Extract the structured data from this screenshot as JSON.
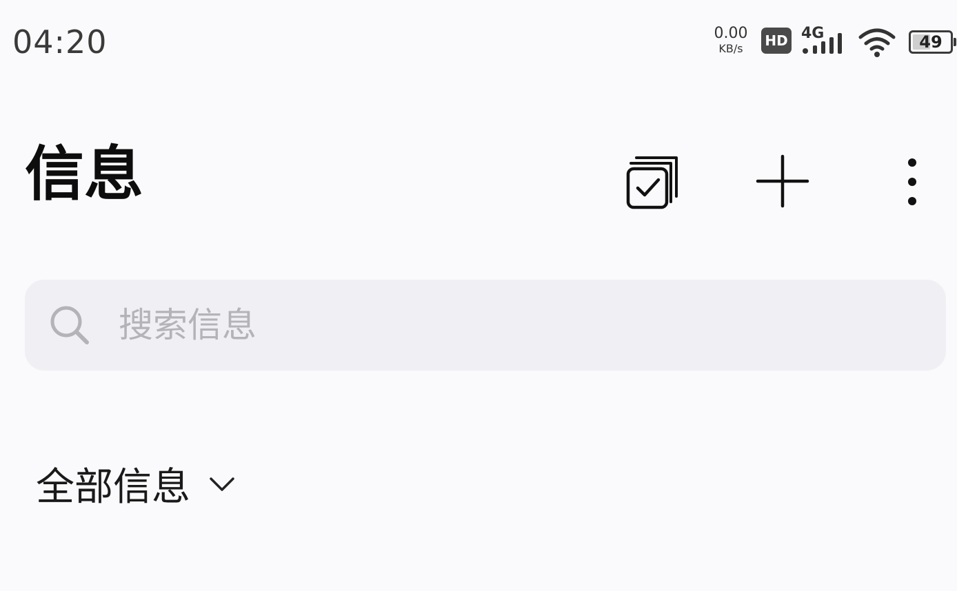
{
  "status_bar": {
    "time": "04:20",
    "net_speed_value": "0.00",
    "net_speed_unit": "KB/s",
    "hd_label": "HD",
    "network_generation": "4G",
    "signal_level": 1.0,
    "wifi_icon": "wifi-icon",
    "battery_percent": "49",
    "battery_level": 0.49
  },
  "header": {
    "title": "信息",
    "actions": [
      {
        "icon": "multi-select-icon"
      },
      {
        "icon": "plus-icon"
      },
      {
        "icon": "more-vertical-icon"
      }
    ]
  },
  "search": {
    "icon": "search-icon",
    "placeholder": "搜索信息",
    "value": ""
  },
  "filter": {
    "label": "全部信息",
    "icon": "chevron-down-icon"
  },
  "colors": {
    "background": "#fafafc",
    "search_bg": "#f0f0f4",
    "placeholder": "#b4b4b8",
    "icon_dark": "#111111"
  }
}
